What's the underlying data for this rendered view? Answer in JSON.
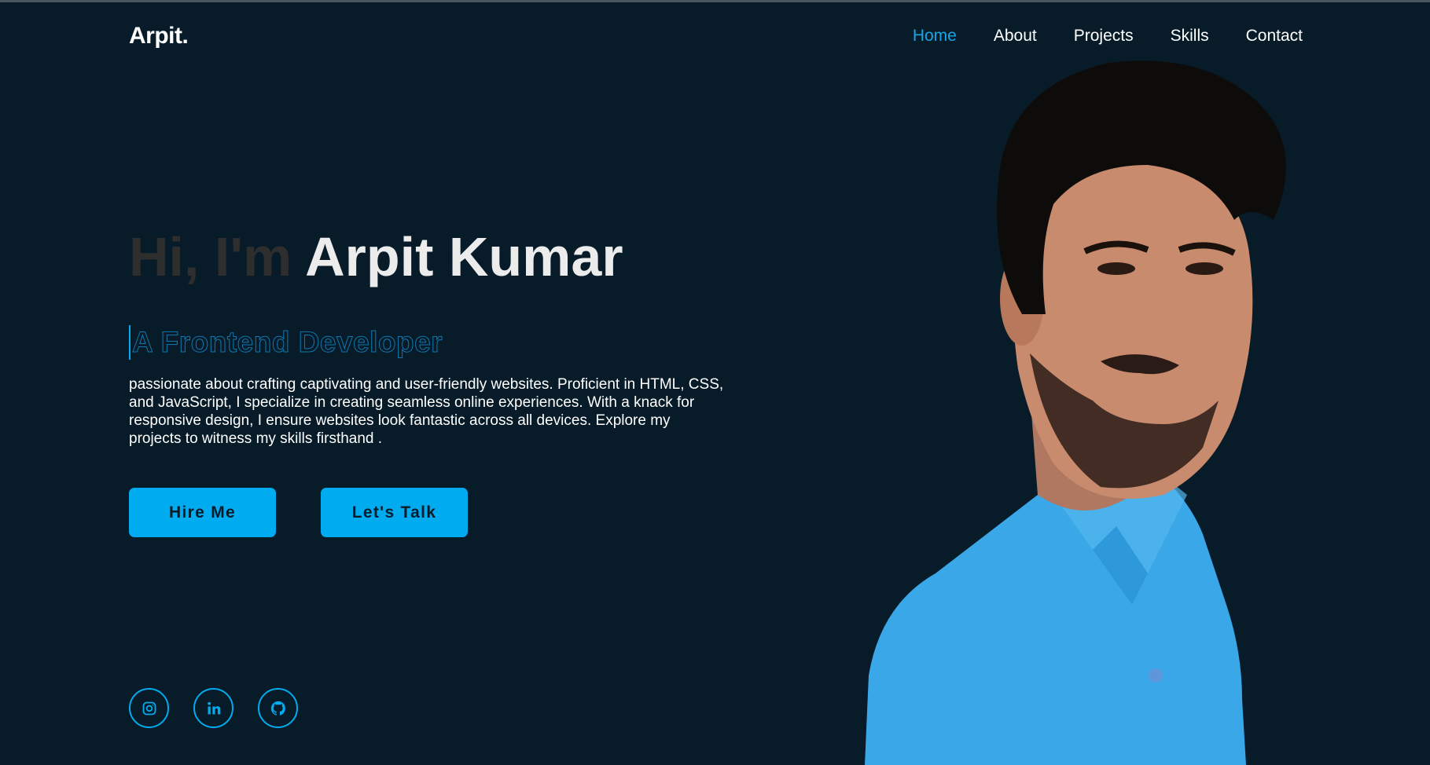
{
  "header": {
    "logo": "Arpit.",
    "nav": [
      "Home",
      "About",
      "Projects",
      "Skills",
      "Contact"
    ],
    "active": "Home"
  },
  "hero": {
    "greeting": "Hi, I'm ",
    "name": "Arpit Kumar",
    "role": "A Frontend Developer",
    "description": "passionate about crafting captivating and user-friendly websites. Proficient in HTML, CSS, and JavaScript, I specialize in creating seamless online experiences. With a knack for responsive design, I ensure websites look fantastic across all devices. Explore my projects to witness my skills firsthand .",
    "buttons": {
      "hire": "Hire Me",
      "talk": "Let's Talk"
    }
  },
  "social": [
    "instagram-icon",
    "linkedin-icon",
    "github-icon"
  ],
  "colors": {
    "background": "#081b29",
    "accent": "#00abf0",
    "greeting": "#2e2e2e",
    "name": "#ececec",
    "shirt": "#3aa8e8"
  }
}
